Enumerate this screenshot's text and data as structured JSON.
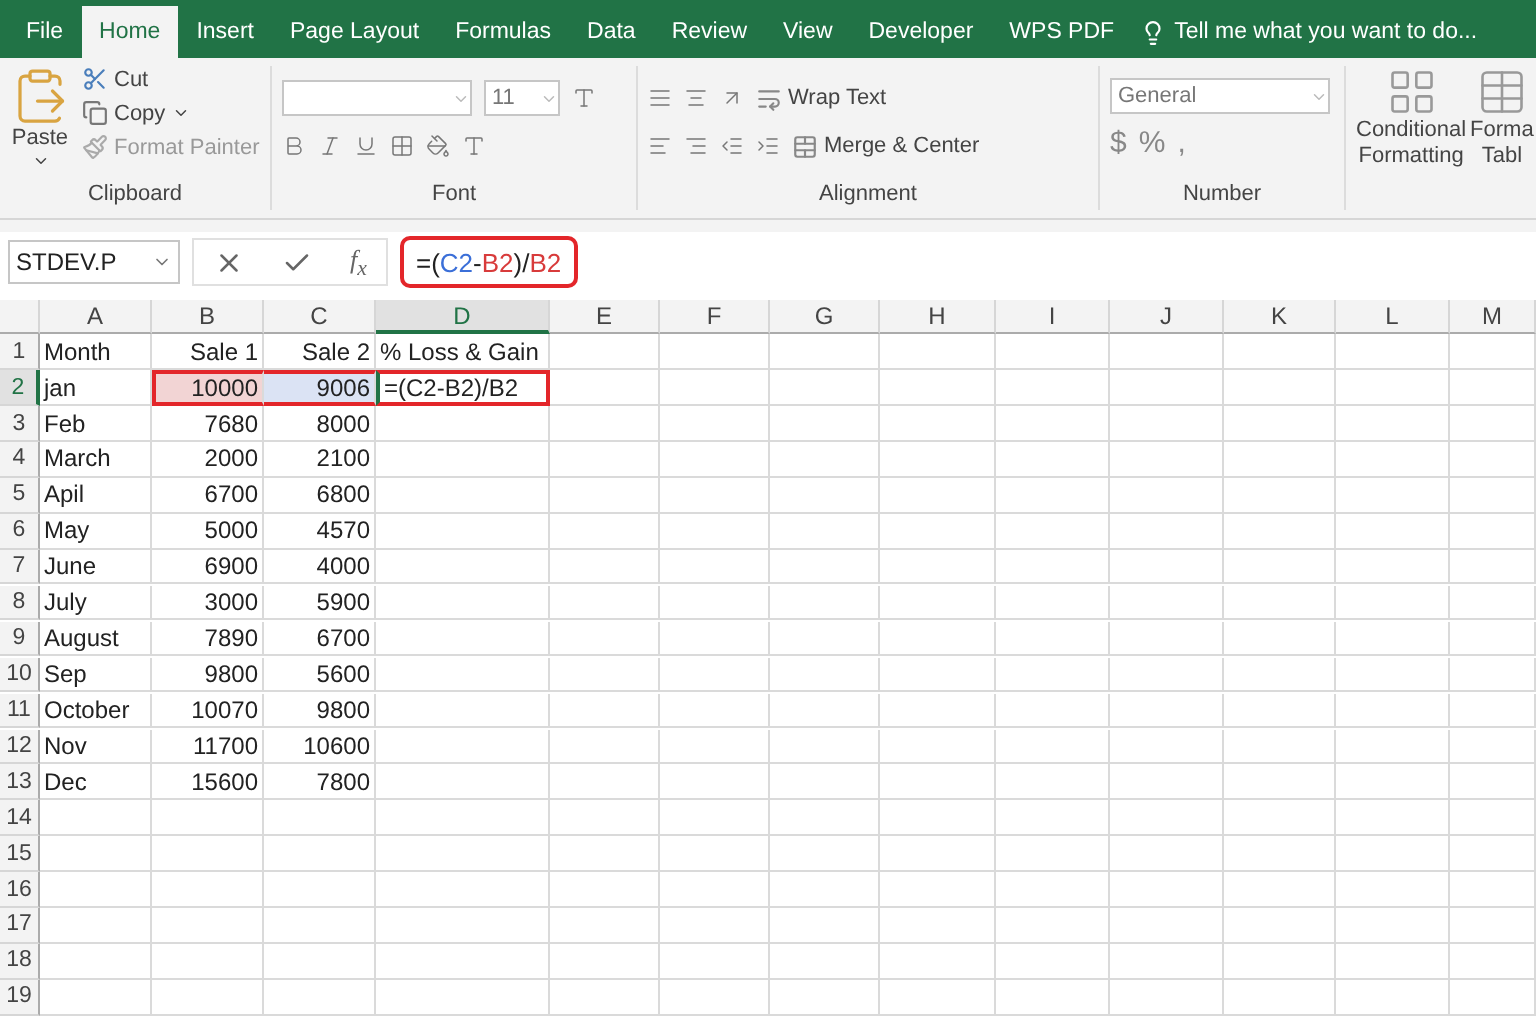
{
  "tabs": [
    {
      "label": "File",
      "selected": false
    },
    {
      "label": "Home",
      "selected": true
    },
    {
      "label": "Insert",
      "selected": false
    },
    {
      "label": "Page Layout",
      "selected": false
    },
    {
      "label": "Formulas",
      "selected": false
    },
    {
      "label": "Data",
      "selected": false
    },
    {
      "label": "Review",
      "selected": false
    },
    {
      "label": "View",
      "selected": false
    },
    {
      "label": "Developer",
      "selected": false
    },
    {
      "label": "WPS PDF",
      "selected": false
    }
  ],
  "tell_me": "Tell me what you want to do...",
  "ribbon": {
    "clipboard": {
      "paste": "Paste",
      "cut": "Cut",
      "copy": "Copy",
      "format_painter": "Format Painter",
      "label": "Clipboard"
    },
    "font": {
      "size": "11",
      "label": "Font"
    },
    "alignment": {
      "wrap": "Wrap Text",
      "merge": "Merge & Center",
      "label": "Alignment"
    },
    "number": {
      "format": "General",
      "symbols": [
        "$",
        "%",
        ","
      ],
      "label": "Number"
    },
    "styles": {
      "conditional": [
        "Conditional",
        "Formatting"
      ],
      "format_table": [
        "Forma",
        "Tabl"
      ]
    }
  },
  "name_box": "STDEV.P",
  "fx": "f$_{x}$",
  "formula": {
    "highlighted": true,
    "parts": [
      {
        "text": "=(",
        "color": "#222222"
      },
      {
        "text": "C2",
        "color": "#3b6fd8"
      },
      {
        "text": "-",
        "color": "#222222"
      },
      {
        "text": "B2",
        "color": "#d83b3b"
      },
      {
        "text": ")/",
        "color": "#222222"
      },
      {
        "text": "B2",
        "color": "#d83b3b"
      }
    ]
  },
  "columns": [
    {
      "label": "A",
      "selected": false,
      "numeric": false
    },
    {
      "label": "B",
      "selected": false,
      "numeric": true
    },
    {
      "label": "C",
      "selected": false,
      "numeric": true
    },
    {
      "label": "D",
      "selected": true,
      "numeric": false
    },
    {
      "label": "E",
      "selected": false,
      "numeric": false
    },
    {
      "label": "F",
      "selected": false,
      "numeric": false
    },
    {
      "label": "G",
      "selected": false,
      "numeric": false
    },
    {
      "label": "H",
      "selected": false,
      "numeric": false
    },
    {
      "label": "I",
      "selected": false,
      "numeric": false
    },
    {
      "label": "J",
      "selected": false,
      "numeric": false
    },
    {
      "label": "K",
      "selected": false,
      "numeric": false
    },
    {
      "label": "L",
      "selected": false,
      "numeric": false
    },
    {
      "label": "M",
      "selected": false,
      "numeric": false
    }
  ],
  "rows": [
    {
      "num": "1",
      "selected": false,
      "callout": false,
      "cells": [
        "Month",
        "Sale 1",
        "Sale 2",
        "% Loss & Gain"
      ]
    },
    {
      "num": "2",
      "selected": true,
      "callout": true,
      "cells": [
        {
          "text": "jan"
        },
        {
          "text": "10000",
          "color": "#f2d4d4"
        },
        {
          "text": "9006",
          "color": "#dbe3f4"
        },
        {
          "text": "=(C2-B2)/B2"
        }
      ]
    },
    {
      "num": "3",
      "selected": false,
      "callout": false,
      "cells": [
        "Feb",
        "7680",
        "8000"
      ]
    },
    {
      "num": "4",
      "selected": false,
      "callout": false,
      "cells": [
        "March",
        "2000",
        "2100"
      ]
    },
    {
      "num": "5",
      "selected": false,
      "callout": false,
      "cells": [
        "Apil",
        "6700",
        "6800"
      ]
    },
    {
      "num": "6",
      "selected": false,
      "callout": false,
      "cells": [
        "May",
        "5000",
        "4570"
      ]
    },
    {
      "num": "7",
      "selected": false,
      "callout": false,
      "cells": [
        "June",
        "6900",
        "4000"
      ]
    },
    {
      "num": "8",
      "selected": false,
      "callout": false,
      "cells": [
        "July",
        "3000",
        "5900"
      ]
    },
    {
      "num": "9",
      "selected": false,
      "callout": false,
      "cells": [
        "August",
        "7890",
        "6700"
      ]
    },
    {
      "num": "10",
      "selected": false,
      "callout": false,
      "cells": [
        "Sep",
        "9800",
        "5600"
      ]
    },
    {
      "num": "11",
      "selected": false,
      "callout": false,
      "cells": [
        "October",
        "10070",
        "9800"
      ]
    },
    {
      "num": "12",
      "selected": false,
      "callout": false,
      "cells": [
        "Nov",
        "11700",
        "10600"
      ]
    },
    {
      "num": "13",
      "selected": false,
      "callout": false,
      "cells": [
        "Dec",
        "15600",
        "7800"
      ]
    },
    {
      "num": "14",
      "selected": false,
      "callout": false,
      "cells": []
    },
    {
      "num": "15",
      "selected": false,
      "callout": false,
      "cells": []
    },
    {
      "num": "16",
      "selected": false,
      "callout": false,
      "cells": []
    },
    {
      "num": "17",
      "selected": false,
      "callout": false,
      "cells": []
    },
    {
      "num": "18",
      "selected": false,
      "callout": false,
      "cells": []
    },
    {
      "num": "19",
      "selected": false,
      "callout": false,
      "cells": []
    }
  ]
}
